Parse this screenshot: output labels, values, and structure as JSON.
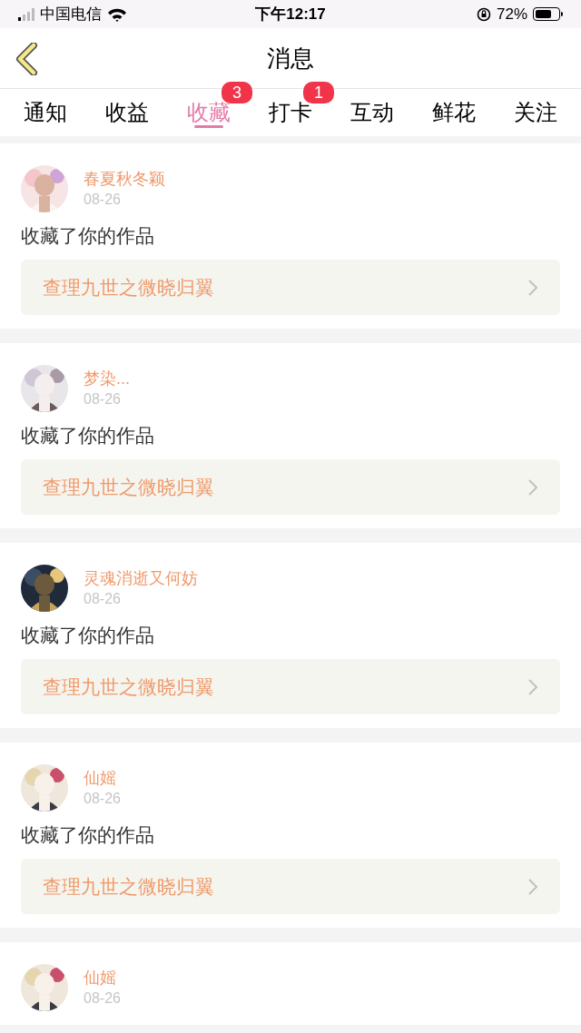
{
  "status_bar": {
    "carrier": "中国电信",
    "time": "下午12:17",
    "battery": "72%"
  },
  "header": {
    "title": "消息"
  },
  "tabs": [
    {
      "label": "通知",
      "selected": false
    },
    {
      "label": "收益",
      "selected": false
    },
    {
      "label": "收藏",
      "selected": true,
      "badge": "3"
    },
    {
      "label": "打卡",
      "selected": false,
      "badge": "1"
    },
    {
      "label": "互动",
      "selected": false
    },
    {
      "label": "鲜花",
      "selected": false
    },
    {
      "label": "关注",
      "selected": false
    }
  ],
  "messages": [
    {
      "user": "春夏秋冬颖",
      "date": "08-26",
      "text": "收藏了你的作品",
      "work": "查理九世之微晓归翼"
    },
    {
      "user": "梦染...",
      "date": "08-26",
      "text": "收藏了你的作品",
      "work": "查理九世之微晓归翼"
    },
    {
      "user": "灵魂消逝又何妨",
      "date": "08-26",
      "text": "收藏了你的作品",
      "work": "查理九世之微晓归翼"
    },
    {
      "user": "仙媱",
      "date": "08-26",
      "text": "收藏了你的作品",
      "work": "查理九世之微晓归翼"
    },
    {
      "user": "仙媱",
      "date": "08-26"
    }
  ]
}
